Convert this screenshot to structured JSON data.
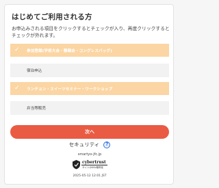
{
  "page": {
    "title": "はじめてご利用される方",
    "description": "お申込みされる項目をクリックするとチェックが入り、再度クリックするとチェックが外れます。"
  },
  "items": [
    {
      "label": "参加登録(学術大会・懇親会・コングレスバッグ)",
      "checked": true
    },
    {
      "label": "宿泊申込",
      "checked": false
    },
    {
      "label": "ランチョン・スイーツセミナー・ワークショップ",
      "checked": true
    },
    {
      "label": "弁当等販売",
      "checked": false
    }
  ],
  "check_icon": "✓",
  "next_button": {
    "label": "次へ"
  },
  "security": {
    "label": "セキュリティ",
    "help_icon": "?"
  },
  "seal": {
    "domain": "smartyo-jfc.jp",
    "brand": "cybertrust",
    "subtitle": "サイトのSSL暗号化",
    "timestamp": "2025-05-12 12:01 JST"
  },
  "colors": {
    "checked_row": "#fbd5a3",
    "unchecked_row": "#f2f2f2",
    "next_button": "#ea5b43",
    "help_icon": "#2f6fd6"
  }
}
